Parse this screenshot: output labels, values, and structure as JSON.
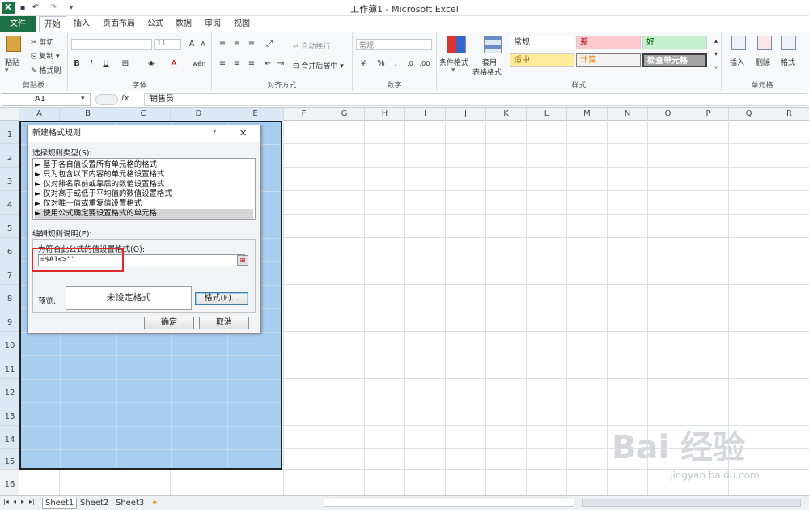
{
  "window": {
    "title": "工作簿1 - Microsoft Excel"
  },
  "tabs": {
    "file": "文件",
    "items": [
      "开始",
      "插入",
      "页面布局",
      "公式",
      "数据",
      "审阅",
      "视图"
    ]
  },
  "ribbon": {
    "clipboard": {
      "paste": "粘贴",
      "cut": "剪切",
      "copy": "复制",
      "format_painter": "格式刷",
      "label": "剪贴板"
    },
    "font": {
      "size": "11",
      "label": "字体",
      "bold": "B",
      "italic": "I",
      "underline": "U",
      "grow": "A",
      "shrink": "A",
      "phonetic": "wén"
    },
    "alignment": {
      "wrap": "自动换行",
      "merge": "合并后居中",
      "label": "对齐方式"
    },
    "number": {
      "format": "常规",
      "label": "数字",
      "percent": "%",
      "comma": ","
    },
    "styles": {
      "cond_format": "条件格式",
      "table_format_1": "套用",
      "table_format_2": "表格格式",
      "label": "样式",
      "cells": [
        {
          "text": "常规",
          "bg": "#ffffff",
          "fg": "#333333",
          "border": "#f0a030"
        },
        {
          "text": "差",
          "bg": "#ffc7ce",
          "fg": "#9c0006",
          "border": "#cccccc"
        },
        {
          "text": "好",
          "bg": "#c6efce",
          "fg": "#006100",
          "border": "#cccccc"
        },
        {
          "text": "适中",
          "bg": "#ffeb9c",
          "fg": "#9c6500",
          "border": "#cccccc"
        },
        {
          "text": "计算",
          "bg": "#f2f2f2",
          "fg": "#fa7d00",
          "border": "#7f7f7f"
        },
        {
          "text": "检查单元格",
          "bg": "#a5a5a5",
          "fg": "#ffffff",
          "border": "#3f3f3f"
        }
      ]
    },
    "cells": {
      "insert": "插入",
      "delete": "删除",
      "format": "格式",
      "label": "单元格"
    }
  },
  "formula_bar": {
    "name_box": "A1",
    "fx": "fx",
    "content": "销售员"
  },
  "columns": [
    "A",
    "B",
    "C",
    "D",
    "E",
    "F",
    "G",
    "H",
    "I",
    "J",
    "K",
    "L",
    "M",
    "N",
    "O",
    "P",
    "Q",
    "R"
  ],
  "rows": [
    "1",
    "2",
    "3",
    "4",
    "5",
    "6",
    "7",
    "8",
    "9",
    "10",
    "11",
    "12",
    "13",
    "14",
    "15",
    "16"
  ],
  "sheets": [
    "Sheet1",
    "Sheet2",
    "Sheet3"
  ],
  "dialog": {
    "title": "新建格式规则",
    "help": "?",
    "close": "✕",
    "select_type_label": "选择规则类型(S):",
    "rules": [
      "► 基于各自值设置所有单元格的格式",
      "► 只为包含以下内容的单元格设置格式",
      "► 仅对排名靠前或靠后的数值设置格式",
      "► 仅对高于或低于平均值的数值设置格式",
      "► 仅对唯一值或重复值设置格式",
      "► 使用公式确定要设置格式的单元格"
    ],
    "edit_label": "编辑规则说明(E):",
    "formula_label": "为符合此公式的值设置格式(O):",
    "formula_value": "=$A1<>\"\"",
    "preview_label": "预览:",
    "preview_text": "未设定格式",
    "format_button": "格式(F)...",
    "ok": "确定",
    "cancel": "取消"
  },
  "watermark": {
    "brand": "Bai 经验",
    "url": "jingyan.baidu.com"
  }
}
